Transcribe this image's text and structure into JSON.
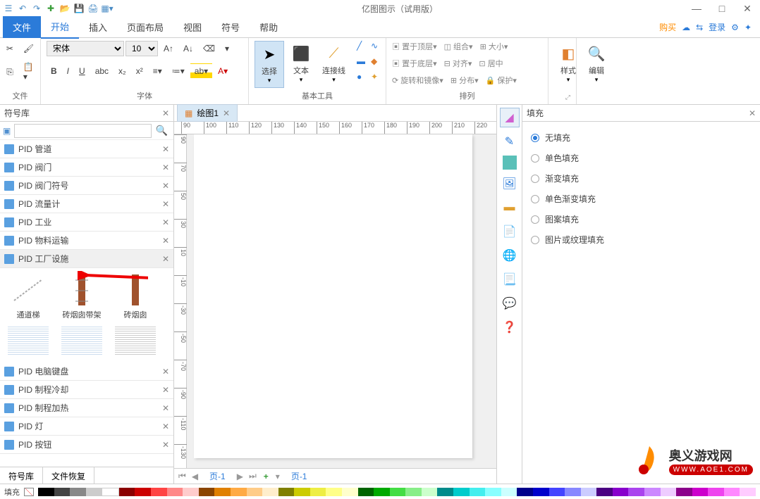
{
  "app": {
    "title": "亿图图示（试用版）"
  },
  "qat": [
    "save",
    "undo",
    "redo",
    "new",
    "open",
    "floppy",
    "print",
    "view"
  ],
  "menus": {
    "file": "文件",
    "tabs": [
      "开始",
      "插入",
      "页面布局",
      "视图",
      "符号",
      "帮助"
    ],
    "right": {
      "buy": "购买",
      "login": "登录"
    }
  },
  "ribbon": {
    "file_group": "文件",
    "font_group": "字体",
    "font_name": "宋体",
    "font_size": "10",
    "tools_group": "基本工具",
    "select": "选择",
    "text": "文本",
    "connector": "连接线",
    "arrange_group": "排列",
    "arrange": {
      "top": "置于顶层",
      "bottom": "置于底层",
      "rotate": "旋转和镜像",
      "group": "组合",
      "align": "对齐",
      "distribute": "分布",
      "size": "大小",
      "center": "居中",
      "protect": "保护"
    },
    "style": "样式",
    "edit": "编辑"
  },
  "left": {
    "title": "符号库",
    "search_placeholder": "",
    "libs": [
      "PID 管道",
      "PID 阀门",
      "PID 阀门符号",
      "PID 流量计",
      "PID 工业",
      "PID 物料运输",
      "PID 工厂设施"
    ],
    "shapes": [
      "通道梯",
      "砖烟囱带架",
      "砖烟囱"
    ],
    "libs2": [
      "PID 电脑键盘",
      "PID 制程冷却",
      "PID 制程加热",
      "PID 灯",
      "PID 按钮"
    ],
    "tabs": {
      "lib": "符号库",
      "recover": "文件恢复"
    }
  },
  "canvas": {
    "doc_tab": "绘图1",
    "ruler_start": 90,
    "page_tab": "页-1",
    "page_tab2": "页-1"
  },
  "right": {
    "title": "填充",
    "opts": [
      "无填充",
      "单色填充",
      "渐变填充",
      "单色渐变填充",
      "图案填充",
      "图片或纹理填充"
    ]
  },
  "status": {
    "fill": "填充"
  },
  "watermark": {
    "brand": "奥义游戏网",
    "url": "WWW.AOE1.COM"
  }
}
